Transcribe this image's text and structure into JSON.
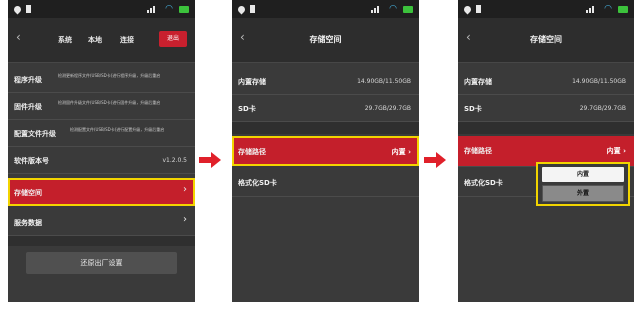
{
  "colors": {
    "highlight": "#c41f2b",
    "outline": "#f2d400",
    "background": "#3a3a3a",
    "arrow": "#e0202a"
  },
  "p1": {
    "header": {
      "tabs": [
        "系统",
        "本地",
        "连接"
      ],
      "exit_label": "退出"
    },
    "rows": [
      {
        "label": "程序升级",
        "desc": "检测更新程序文件(USB/SD卡)进行程序升级，升级后重启"
      },
      {
        "label": "固件升级",
        "desc": "检测固件升级文件(USB/SD卡)进行固件升级，升级后重启"
      },
      {
        "label": "配置文件升级",
        "desc": "检测配置文件(USB/SD卡)进行配置升级，升级后重启"
      },
      {
        "label": "软件版本号",
        "value": "v1.2.0.5"
      },
      {
        "label": "存储空间",
        "chevron": "›"
      },
      {
        "label": "服务数据",
        "chevron": "›"
      }
    ],
    "button": "还原出厂设置"
  },
  "p2": {
    "title": "存储空间",
    "rows": [
      {
        "label": "内置存储",
        "value": "14.90GB/11.50GB"
      },
      {
        "label": "SD卡",
        "value": "29.7GB/29.7GB"
      },
      {
        "label": "存储路径",
        "value": "内置 ›"
      },
      {
        "label": "格式化SD卡"
      }
    ]
  },
  "p3": {
    "title": "存储空间",
    "rows": [
      {
        "label": "内置存储",
        "value": "14.90GB/11.50GB"
      },
      {
        "label": "SD卡",
        "value": "29.7GB/29.7GB"
      },
      {
        "label": "存储路径",
        "value": "内置 ›"
      },
      {
        "label": "格式化SD卡"
      }
    ],
    "dropdown": {
      "options": [
        "内置",
        "外置"
      ],
      "selected": "内置"
    }
  }
}
